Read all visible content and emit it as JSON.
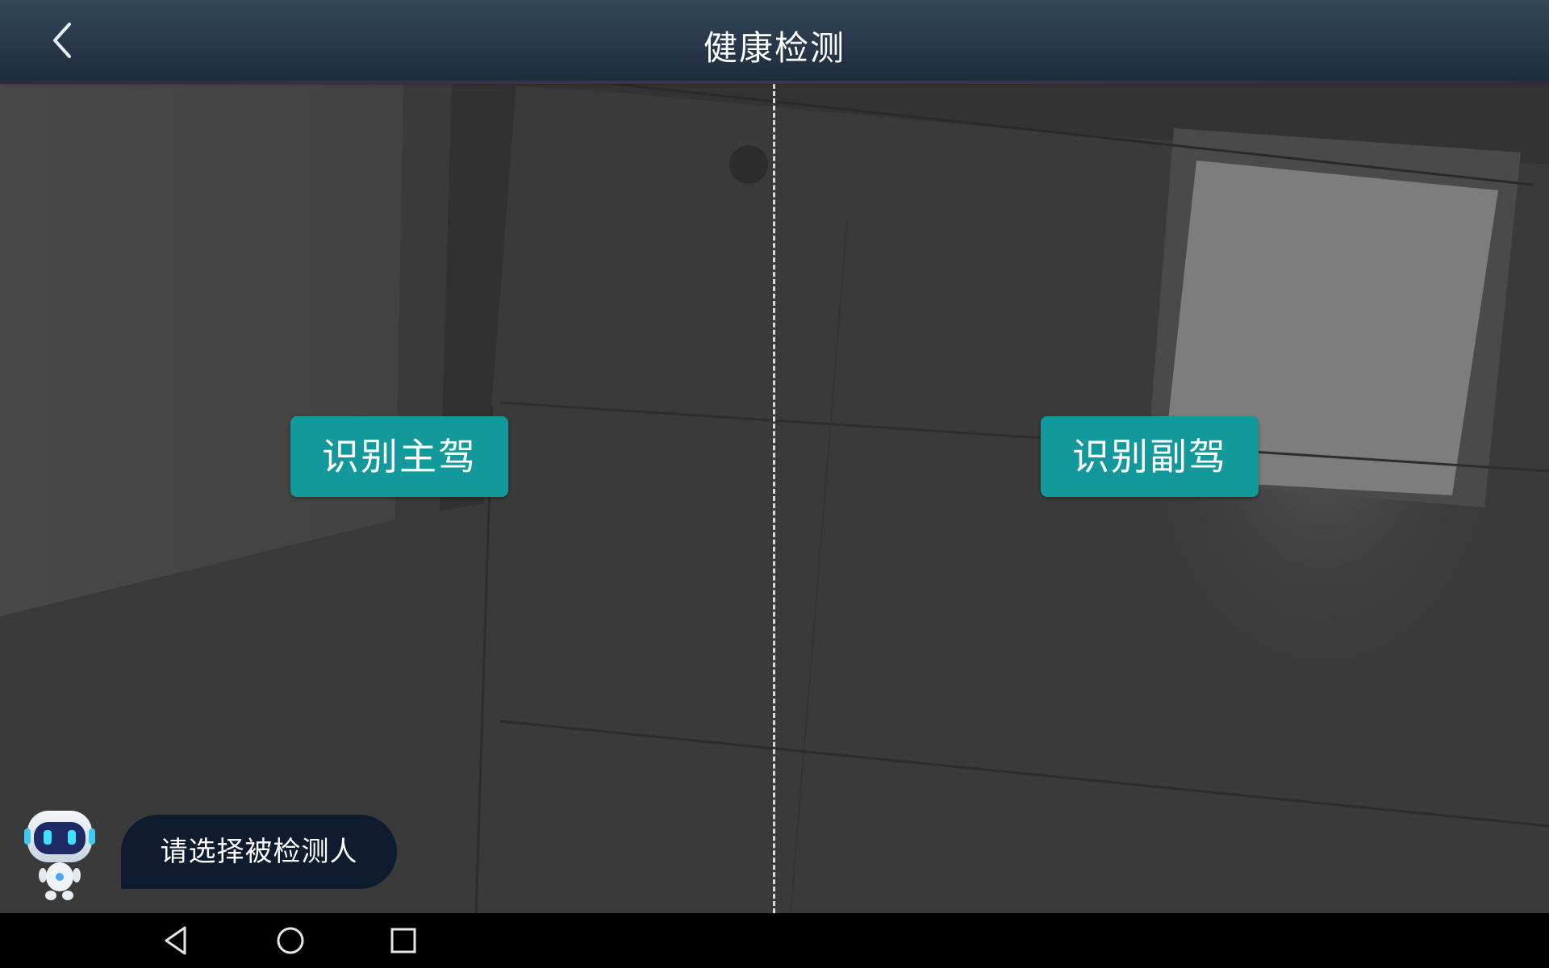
{
  "header": {
    "title": "健康检测",
    "back_icon": "chevron-left-icon"
  },
  "main": {
    "buttons": {
      "driver_label": "识别主驾",
      "passenger_label": "识别副驾"
    },
    "accent_color": "#13989b"
  },
  "assistant": {
    "icon": "robot-assistant-icon",
    "message": "请选择被检测人"
  },
  "navbar": {
    "icons": [
      "back-triangle-icon",
      "home-circle-icon",
      "recents-square-icon"
    ]
  }
}
